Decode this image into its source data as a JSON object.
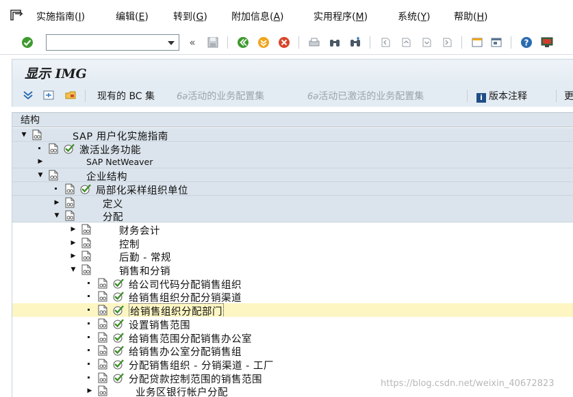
{
  "menubar": {
    "items": [
      {
        "label": "实施指南",
        "key": "I"
      },
      {
        "label": "编辑",
        "key": "E"
      },
      {
        "label": "转到",
        "key": "G"
      },
      {
        "label": "附加信息",
        "key": "A"
      },
      {
        "label": "实用程序",
        "key": "M"
      },
      {
        "label": "系统",
        "key": "Y"
      },
      {
        "label": "帮助",
        "key": "H"
      }
    ]
  },
  "toolbar": {
    "command_value": "",
    "nav_back_label": "«"
  },
  "title": "显示 IMG",
  "apptoolbar": {
    "bc_sets": "现有的 BC 集",
    "active_bc": "活动的业务配置集",
    "activated_bc": "活动已激活的业务配置集",
    "release_notes": "版本注释",
    "more": "更"
  },
  "tree": {
    "header": "结构",
    "rows": [
      {
        "text": "SAP 用户化实施指南"
      },
      {
        "text": "激活业务功能"
      },
      {
        "text": "SAP NetWeaver"
      },
      {
        "text": "企业结构"
      },
      {
        "text": "局部化采样组织单位"
      },
      {
        "text": "定义"
      },
      {
        "text": "分配"
      },
      {
        "text": "财务会计"
      },
      {
        "text": "控制"
      },
      {
        "text": "后勤 - 常规"
      },
      {
        "text": "销售和分销"
      },
      {
        "text": "给公司代码分配销售组织"
      },
      {
        "text": "给销售组织分配分销渠道"
      },
      {
        "text": "给销售组织分配部门"
      },
      {
        "text": "设置销售范围"
      },
      {
        "text": "给销售范围分配销售办公室"
      },
      {
        "text": "给销售办公室分配销售组"
      },
      {
        "text": "分配销售组织 - 分销渠道 - 工厂"
      },
      {
        "text": "分配贷款控制范围的销售范围"
      },
      {
        "text": "业务区银行帐户分配"
      }
    ]
  },
  "colors": {
    "highlight_row": "#fdf6c3",
    "panel_blue": "#dbe4ec",
    "check_green": "#3f8f2a"
  },
  "watermark": "https://blog.csdn.net/weixin_40672823"
}
